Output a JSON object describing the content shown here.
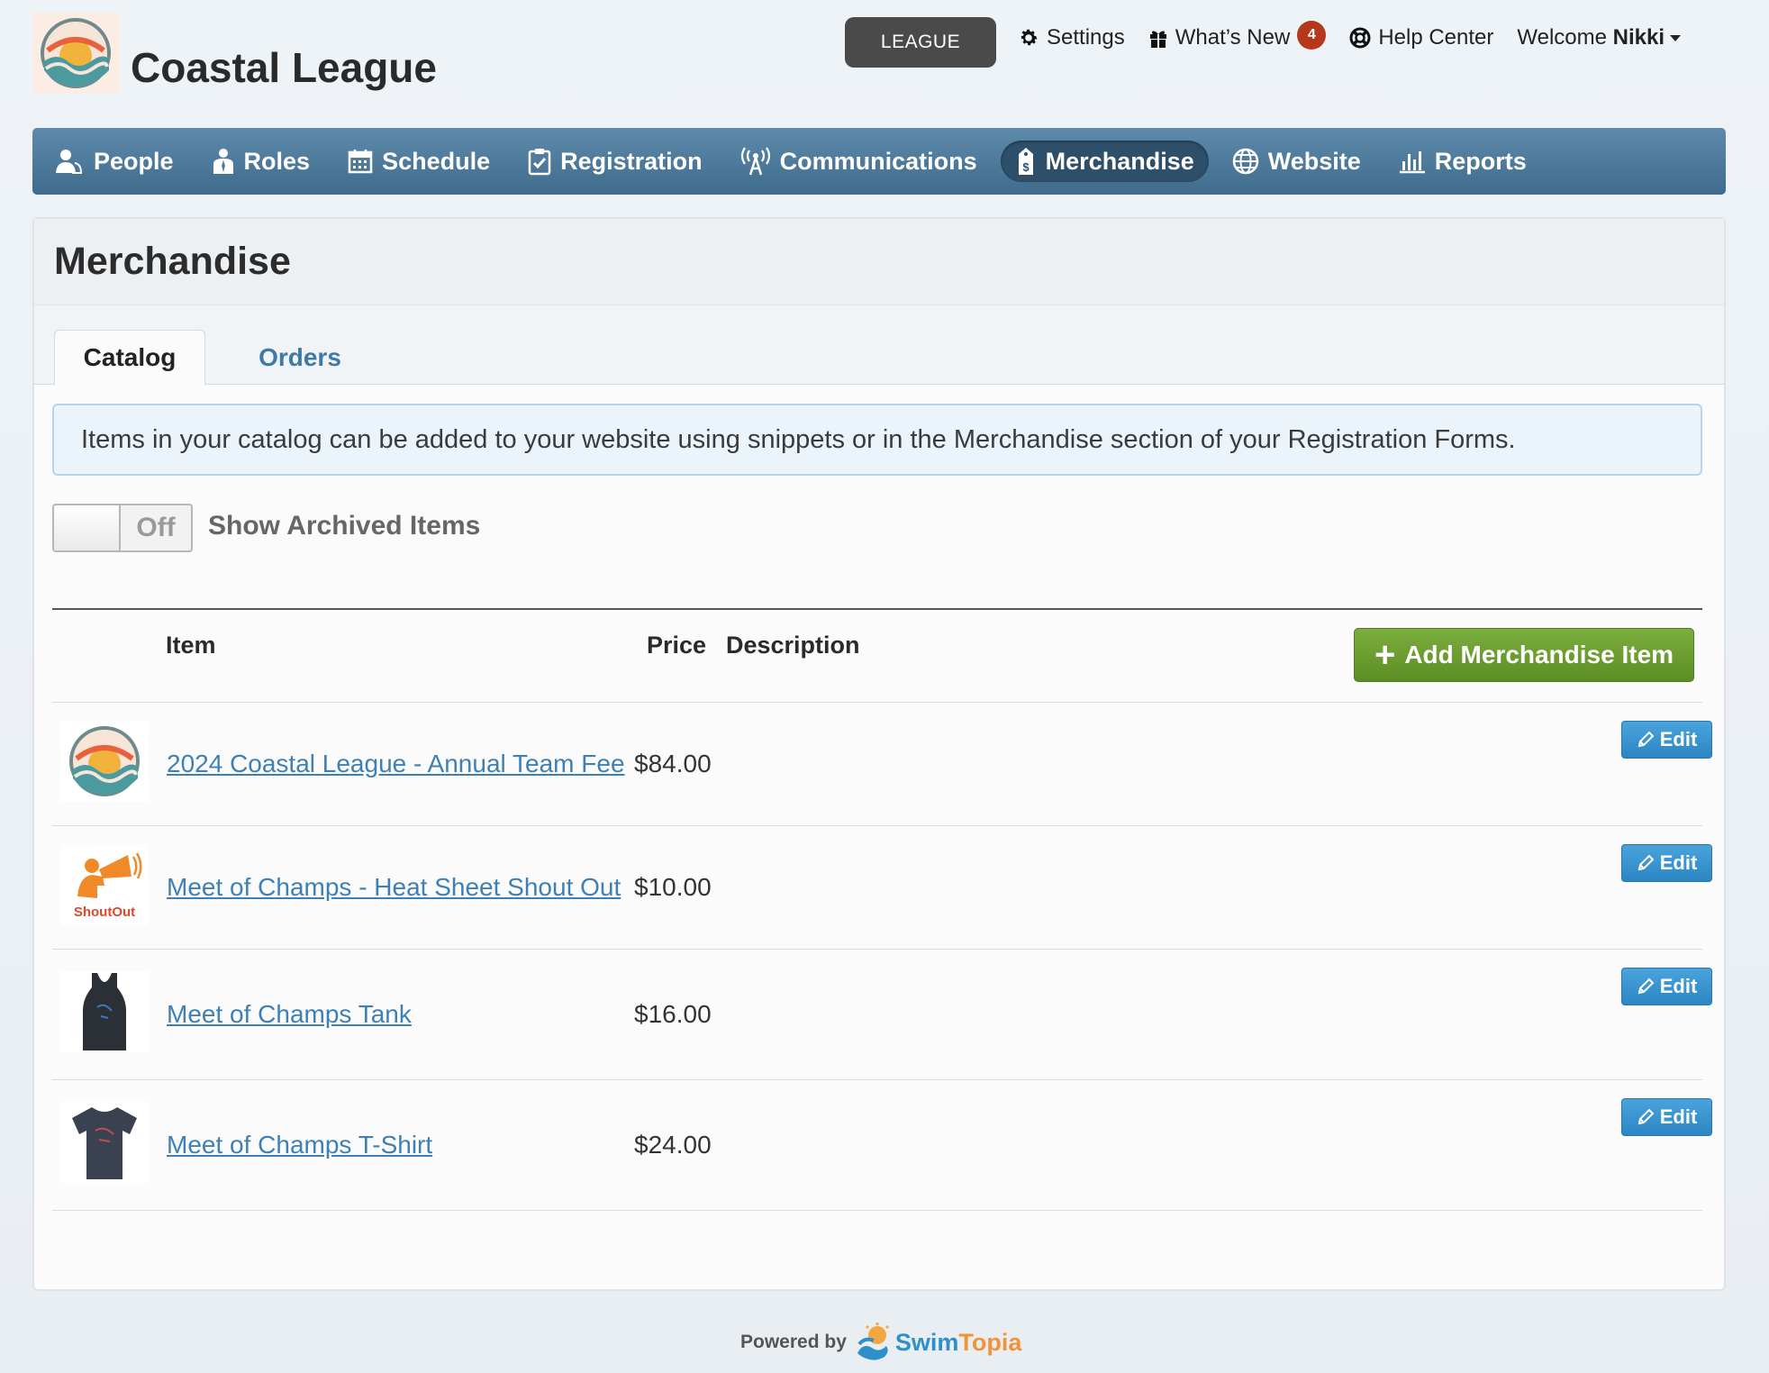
{
  "header": {
    "league_name": "Coastal League",
    "league_button": "LEAGUE",
    "settings": "Settings",
    "whats_new": "What’s New",
    "whats_new_count": "4",
    "help_center": "Help Center",
    "welcome_prefix": "Welcome",
    "user_name": "Nikki"
  },
  "nav": {
    "items": [
      {
        "label": "People",
        "icon": "people-icon"
      },
      {
        "label": "Roles",
        "icon": "roles-icon"
      },
      {
        "label": "Schedule",
        "icon": "calendar-icon"
      },
      {
        "label": "Registration",
        "icon": "clipboard-icon"
      },
      {
        "label": "Communications",
        "icon": "antenna-icon"
      },
      {
        "label": "Merchandise",
        "icon": "price-tag-icon",
        "active": true
      },
      {
        "label": "Website",
        "icon": "globe-icon"
      },
      {
        "label": "Reports",
        "icon": "bar-chart-icon"
      }
    ]
  },
  "page": {
    "title": "Merchandise",
    "tabs": [
      {
        "label": "Catalog",
        "active": true
      },
      {
        "label": "Orders",
        "active": false
      }
    ],
    "info_text": "Items in your catalog can be added to your website using snippets or in the Merchandise section of your Registration Forms.",
    "archived_toggle": {
      "state": "Off",
      "label": "Show Archived Items"
    }
  },
  "table": {
    "columns": {
      "item": "Item",
      "price": "Price",
      "description": "Description"
    },
    "add_button": "Add Merchandise Item",
    "edit_label": "Edit",
    "rows": [
      {
        "name": "2024 Coastal League - Annual Team Fee",
        "price": "$84.00",
        "thumb": "coastal-league-logo",
        "thumb_text": ""
      },
      {
        "name": "Meet of Champs - Heat Sheet Shout Out",
        "price": "$10.00",
        "thumb": "shoutout-megaphone",
        "thumb_text": "ShoutOut"
      },
      {
        "name": "Meet of Champs Tank",
        "price": "$16.00",
        "thumb": "tank-top",
        "thumb_text": ""
      },
      {
        "name": "Meet of Champs T-Shirt",
        "price": "$24.00",
        "thumb": "t-shirt",
        "thumb_text": ""
      }
    ]
  },
  "footer": {
    "powered_by": "Powered by",
    "brand_a": "Swim",
    "brand_b": "Topia"
  },
  "colors": {
    "nav_bar": "#4f7b9c",
    "nav_active": "#2e4f6a",
    "link": "#3e80b5",
    "add_button": "#6b9e30",
    "edit_button": "#3895d3",
    "badge": "#b5381c"
  }
}
